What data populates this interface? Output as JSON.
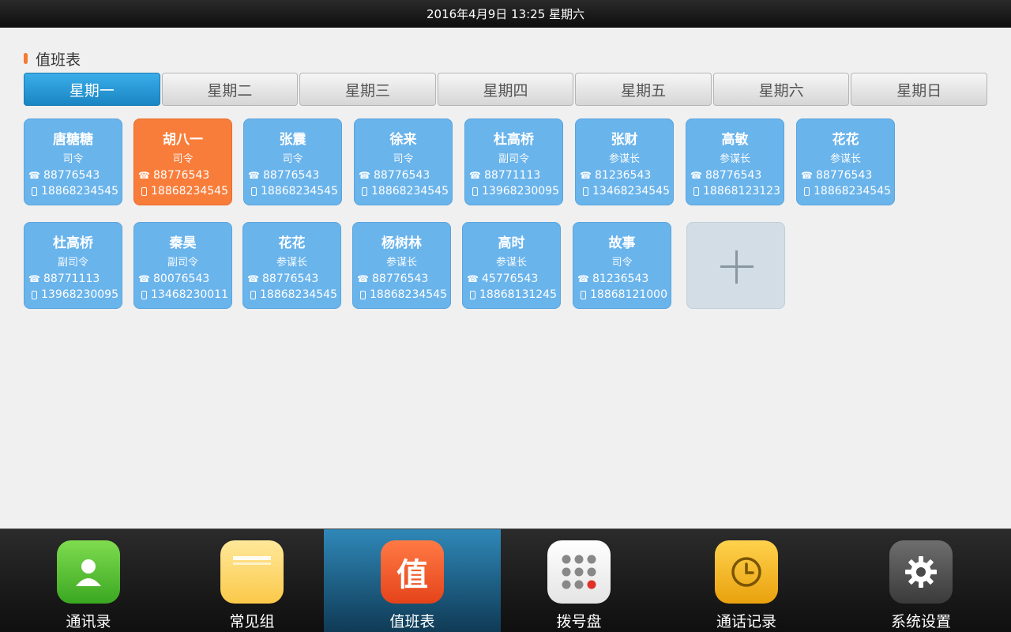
{
  "status_bar": {
    "datetime": "2016年4月9日  13:25  星期六"
  },
  "section": {
    "title": "值班表"
  },
  "tabs": [
    {
      "label": "星期一",
      "active": true
    },
    {
      "label": "星期二",
      "active": false
    },
    {
      "label": "星期三",
      "active": false
    },
    {
      "label": "星期四",
      "active": false
    },
    {
      "label": "星期五",
      "active": false
    },
    {
      "label": "星期六",
      "active": false
    },
    {
      "label": "星期日",
      "active": false
    }
  ],
  "cards_row1": [
    {
      "name": "唐糖糖",
      "role": "司令",
      "phone": "88776543",
      "mobile": "18868234545",
      "highlight": false
    },
    {
      "name": "胡八一",
      "role": "司令",
      "phone": "88776543",
      "mobile": "18868234545",
      "highlight": true
    },
    {
      "name": "张震",
      "role": "司令",
      "phone": "88776543",
      "mobile": "18868234545",
      "highlight": false
    },
    {
      "name": "徐来",
      "role": "司令",
      "phone": "88776543",
      "mobile": "18868234545",
      "highlight": false
    },
    {
      "name": "杜高桥",
      "role": "副司令",
      "phone": "88771113",
      "mobile": "13968230095",
      "highlight": false
    },
    {
      "name": "张财",
      "role": "参谋长",
      "phone": "81236543",
      "mobile": "13468234545",
      "highlight": false
    },
    {
      "name": "高敏",
      "role": "参谋长",
      "phone": "88776543",
      "mobile": "18868123123",
      "highlight": false
    },
    {
      "name": "花花",
      "role": "参谋长",
      "phone": "88776543",
      "mobile": "18868234545",
      "highlight": false
    }
  ],
  "cards_row2": [
    {
      "name": "杜高桥",
      "role": "副司令",
      "phone": "88771113",
      "mobile": "13968230095",
      "highlight": false
    },
    {
      "name": "秦昊",
      "role": "副司令",
      "phone": "80076543",
      "mobile": "13468230011",
      "highlight": false
    },
    {
      "name": "花花",
      "role": "参谋长",
      "phone": "88776543",
      "mobile": "18868234545",
      "highlight": false
    },
    {
      "name": "杨树林",
      "role": "参谋长",
      "phone": "88776543",
      "mobile": "18868234545",
      "highlight": false
    },
    {
      "name": "高时",
      "role": "参谋长",
      "phone": "45776543",
      "mobile": "18868131245",
      "highlight": false
    },
    {
      "name": "故事",
      "role": "司令",
      "phone": "81236543",
      "mobile": "18868121000",
      "highlight": false
    }
  ],
  "icons": {
    "phone": "phone-icon",
    "mobile": "mobile-icon",
    "add": "plus-icon"
  },
  "dock": [
    {
      "label": "通讯录",
      "icon": "contacts-icon",
      "active": false
    },
    {
      "label": "常见组",
      "icon": "folder-icon",
      "active": false
    },
    {
      "label": "值班表",
      "icon": "duty-icon",
      "glyph": "值",
      "active": true
    },
    {
      "label": "拨号盘",
      "icon": "dialpad-icon",
      "active": false
    },
    {
      "label": "通话记录",
      "icon": "clock-icon",
      "active": false
    },
    {
      "label": "系统设置",
      "icon": "gear-icon",
      "active": false
    }
  ],
  "colors": {
    "tab_active": "#1a86c4",
    "card_blue": "#6ab4ec",
    "card_highlight": "#f97d3a",
    "title_marker": "#f47b30",
    "dock_active": "#2f88b8"
  }
}
